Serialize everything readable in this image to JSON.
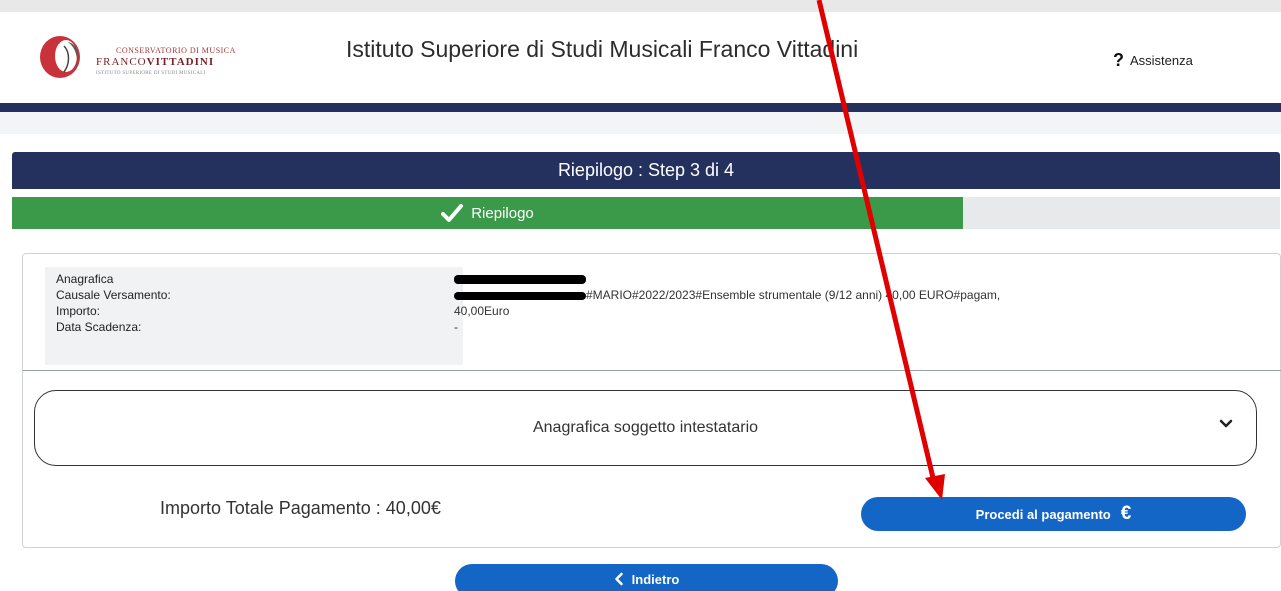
{
  "header": {
    "logo_line1": "CONSERVATORIO DI MUSICA",
    "logo_line2a": "FRANCO",
    "logo_line2b": "VITTADINI",
    "logo_line3": "ISTITUTO SUPERIORE DI STUDI MUSICALI",
    "title": "Istituto Superiore di Studi Musicali Franco Vittadini",
    "help_icon": "?",
    "help_label": "Assistenza"
  },
  "step_title": "Riepilogo : Step 3 di 4",
  "progress": {
    "label": "Riepilogo",
    "fraction": 0.75,
    "icon": "check-icon"
  },
  "summary": {
    "rows": [
      {
        "label": "Anagrafica",
        "value": ""
      },
      {
        "label": "Causale Versamento:",
        "value": "#MARIO#2022/2023#Ensemble strumentale (9/12 anni) 40,00 EURO#pagam,"
      },
      {
        "label": "Importo:",
        "value": "40,00Euro"
      },
      {
        "label": "Data Scadenza:",
        "value": "-"
      }
    ]
  },
  "accordion": {
    "label": "Anagrafica soggetto intestatario",
    "icon": "chevron-down-icon"
  },
  "total": {
    "label": "Importo Totale Pagamento : 40,00€"
  },
  "buttons": {
    "pay_label": "Procedi al pagamento",
    "pay_icon": "€",
    "back_label": "Indietro",
    "back_icon": "chevron-left-icon"
  },
  "colors": {
    "navy": "#24315e",
    "green": "#3b9a4a",
    "blue": "#1466c6",
    "annotation_red": "#e00000"
  }
}
